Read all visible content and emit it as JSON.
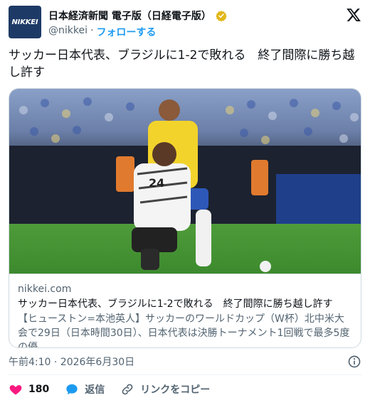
{
  "account": {
    "display_name": "日本経済新聞 電子版（日経電子版）",
    "handle": "@nikkei",
    "separator": "·",
    "follow_label": "フォローする",
    "avatar_text": "NIKKEI",
    "verified_color": "#e2b719"
  },
  "tweet": {
    "text": "サッカー日本代表、ブラジルに1-2で敗れる　終了間際に勝ち越し許す"
  },
  "card": {
    "domain": "nikkei.com",
    "title": "サッカー日本代表、ブラジルに1-2で敗れる　終了間際に勝ち越し許す",
    "description": "【ヒューストン=本池英人】サッカーのワールドカップ（W杯）北中米大会で29日（日本時間30日）、日本代表は決勝トーナメント1回戦で最多5度の優...",
    "image_jersey_number": "24"
  },
  "meta": {
    "timestamp": "午前4:10 · 2026年6月30日"
  },
  "actions": {
    "like_count": "180",
    "reply_label": "返信",
    "copy_link_label": "リンクをコピー"
  },
  "colors": {
    "like": "#f91880",
    "reply": "#1d9bf0",
    "brand_blue": "#1d3a66"
  }
}
